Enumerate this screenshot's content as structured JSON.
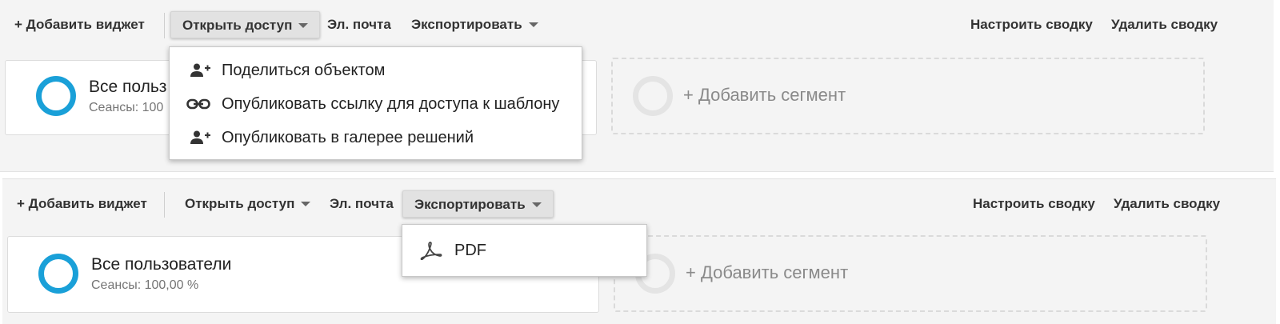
{
  "top_panel": {
    "toolbar": {
      "add_widget": "+ Добавить виджет",
      "share": "Открыть доступ",
      "email": "Эл. почта",
      "export": "Экспортировать",
      "customize": "Настроить сводку",
      "delete": "Удалить сводку"
    },
    "segment": {
      "name": "Все польз",
      "subtitle": "Сеансы: 100"
    },
    "add_segment": "+ Добавить сегмент",
    "share_menu": [
      {
        "icon": "person-add-icon",
        "label": "Поделиться объектом"
      },
      {
        "icon": "link-icon",
        "label": "Опубликовать ссылку для доступа к шаблону"
      },
      {
        "icon": "person-add-icon",
        "label": "Опубликовать в галерее решений"
      }
    ]
  },
  "bottom_panel": {
    "toolbar": {
      "add_widget": "+ Добавить виджет",
      "share": "Открыть доступ",
      "email": "Эл. почта",
      "export": "Экспортировать",
      "customize": "Настроить сводку",
      "delete": "Удалить сводку"
    },
    "segment": {
      "name": "Все пользователи",
      "subtitle": "Сеансы: 100,00 %"
    },
    "add_segment": "+ Добавить сегмент",
    "export_menu": [
      {
        "icon": "pdf-icon",
        "label": "PDF"
      }
    ]
  },
  "colors": {
    "accent": "#1aa0d8",
    "toolbar_bg": "#f4f4f4"
  }
}
